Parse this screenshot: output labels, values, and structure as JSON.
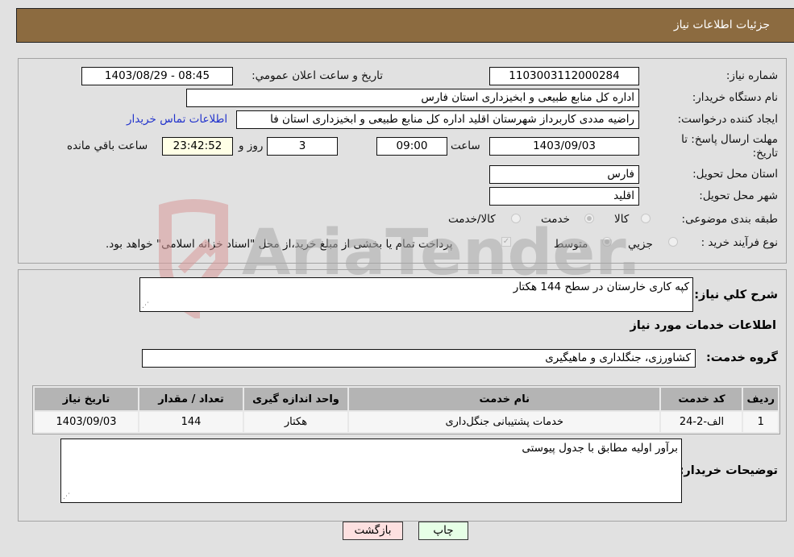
{
  "header": {
    "title": "جزئیات اطلاعات نیاز"
  },
  "form": {
    "need_number_label": "شماره نیاز:",
    "need_number": "1103003112000284",
    "announce_label": "تاریخ و ساعت اعلان عمومي:",
    "announce_value": "1403/08/29 - 08:45",
    "buyer_org_label": "نام دستگاه خریدار:",
    "buyer_org": "اداره کل منابع طبیعی و ابخیزداری استان فارس",
    "creator_label": "ایجاد کننده درخواست:",
    "creator": "راضیه مددی کاربرداز شهرستان اقلید اداره کل منابع طبیعی و ابخیزداری استان فا",
    "contact_link": "اطلاعات تماس خریدار",
    "deadline_label": "مهلت ارسال پاسخ: تا تاریخ:",
    "deadline_date": "1403/09/03",
    "time_label": "ساعت",
    "deadline_time": "09:00",
    "days_value": "3",
    "days_label": "روز و",
    "remaining_time": "23:42:52",
    "remaining_label": "ساعت باقي مانده",
    "province_label": "استان محل تحویل:",
    "province": "فارس",
    "city_label": "شهر محل تحویل:",
    "city": "اقلید",
    "category_label": "طبقه بندی موضوعی:",
    "category_options": [
      "کالا",
      "خدمت",
      "کالا/خدمت"
    ],
    "category_selected": "خدمت",
    "process_label": "نوع فرآیند خرید :",
    "process_options": [
      "جزيي",
      "متوسط"
    ],
    "process_selected": "متوسط",
    "treasury_note": "پرداخت تمام یا بخشی از مبلغ خرید،از محل \"اسناد خزانه اسلامی\" خواهد بود.",
    "treasury_checked": true
  },
  "details": {
    "summary_label": "شرح كلي نياز:",
    "summary": "کپه کاری خارستان در سطح 144 هکتار",
    "services_heading": "اطلاعات خدمات مورد نياز",
    "service_group_label": "گروه خدمت:",
    "service_group": "کشاورزی، جنگلداری و ماهیگیری",
    "table": {
      "headers": [
        "رديف",
        "كد خدمت",
        "نام خدمت",
        "واحد اندازه گيری",
        "تعداد / مقدار",
        "تاريخ نياز"
      ],
      "rows": [
        [
          "1",
          "الف-2-24",
          "خدمات پشتیبانی جنگل‌داری",
          "هکتار",
          "144",
          "1403/09/03"
        ]
      ]
    },
    "buyer_notes_label": "توضیحات خریدار:",
    "buyer_notes": "برآور اولیه مطابق با جدول پیوستی"
  },
  "buttons": {
    "back": "بازگشت",
    "print": "چاپ"
  },
  "watermark": {
    "text": "AriaTender.neT"
  },
  "colors": {
    "header_bg": "#8c6b40",
    "page_bg": "#e1e1e1",
    "link": "#2233cc",
    "back_btn": "#fde0e0",
    "print_btn": "#e6ffe6"
  }
}
